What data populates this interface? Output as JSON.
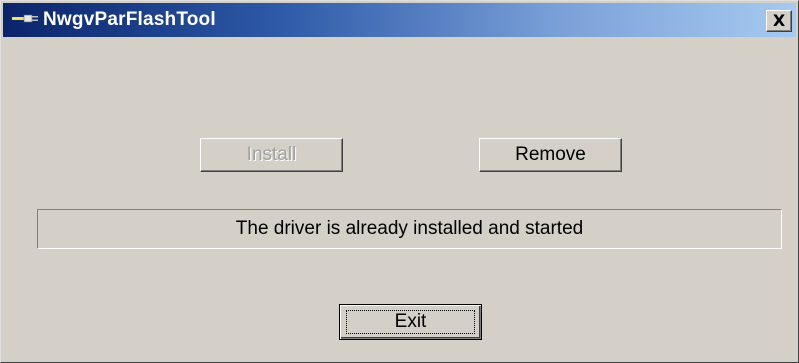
{
  "window": {
    "title": "NwgvParFlashTool",
    "icon": "app-plug-icon",
    "close_label": "X"
  },
  "buttons": {
    "install_label": "Install",
    "install_enabled": false,
    "remove_label": "Remove",
    "exit_label": "Exit"
  },
  "status": {
    "message": "The driver is already installed and started"
  },
  "colors": {
    "face": "#d4d0c8",
    "title_active_start": "#0a246a",
    "title_active_end": "#a6caf0",
    "disabled_text": "#a0a0a0"
  }
}
